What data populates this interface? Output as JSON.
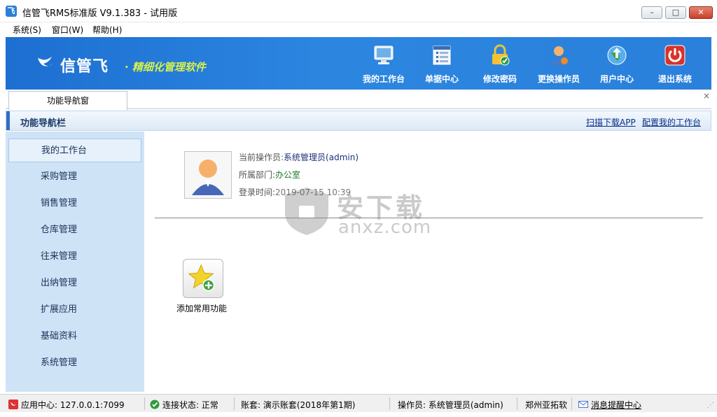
{
  "window": {
    "title": "信管飞RMS标准版 V9.1.383 - 试用版",
    "minimize": "–",
    "maximize": "□",
    "close": "✕"
  },
  "menu": [
    "系统(S)",
    "窗口(W)",
    "帮助(H)"
  ],
  "banner": {
    "brand": "信管飞",
    "tagline": "· 精细化管理软件",
    "buttons": [
      {
        "label": "我的工作台",
        "icon": "monitor-icon"
      },
      {
        "label": "单据中心",
        "icon": "document-list-icon"
      },
      {
        "label": "修改密码",
        "icon": "lock-icon"
      },
      {
        "label": "更换操作员",
        "icon": "user-icon"
      },
      {
        "label": "用户中心",
        "icon": "globe-icon"
      },
      {
        "label": "退出系统",
        "icon": "power-icon"
      }
    ]
  },
  "tabs": {
    "active": "功能导航窗",
    "close": "×"
  },
  "nav_header": {
    "title": "功能导航栏",
    "links": [
      "扫描下载APP",
      "配置我的工作台"
    ]
  },
  "sidebar": {
    "items": [
      "我的工作台",
      "采购管理",
      "销售管理",
      "仓库管理",
      "往来管理",
      "出纳管理",
      "扩展应用",
      "基础资料",
      "系统管理"
    ],
    "active_index": 0
  },
  "profile": {
    "operator_label": "当前操作员:",
    "operator_value": "系统管理员(admin)",
    "dept_label": "所属部门:",
    "dept_value": "办公室",
    "login_label": "登录时间:",
    "login_value": "2019-07-15 10:39"
  },
  "favorites": {
    "add_label": "添加常用功能"
  },
  "watermark": {
    "text": "安下载",
    "sub": "anxz.com"
  },
  "statusbar": {
    "app_center": "应用中心: 127.0.0.1:7099",
    "connection": "连接状态: 正常",
    "account": "账套: 演示账套(2018年第1期)",
    "operator": "操作员: 系统管理员(admin)",
    "company": "郑州亚拓软",
    "messages": "消息提醒中心"
  },
  "colors": {
    "banner": "#2a80db",
    "sidebar": "#cfe3f7",
    "accent": "#2f6fc4"
  }
}
